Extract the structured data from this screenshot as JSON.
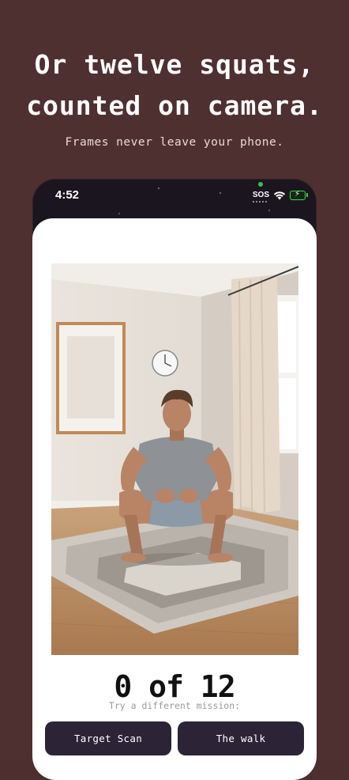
{
  "headline": {
    "line1": "Or twelve squats,",
    "line2": "counted on camera."
  },
  "subheadline": "Frames never leave your phone.",
  "status_bar": {
    "time": "4:52",
    "sos": "SOS",
    "icons": [
      "wifi-icon",
      "battery-charging-icon"
    ],
    "battery_color": "#3fd24f"
  },
  "camera_preview": {
    "subject": "man-squatting-in-living-room"
  },
  "counter": {
    "text": "0 of 12",
    "count": 0,
    "target": 12
  },
  "hint": "Try a different mission:",
  "missions": [
    {
      "label": "Target Scan"
    },
    {
      "label": "The walk"
    }
  ],
  "colors": {
    "background": "#4f3030",
    "button": "#2c2436",
    "sheet": "#ffffff"
  }
}
